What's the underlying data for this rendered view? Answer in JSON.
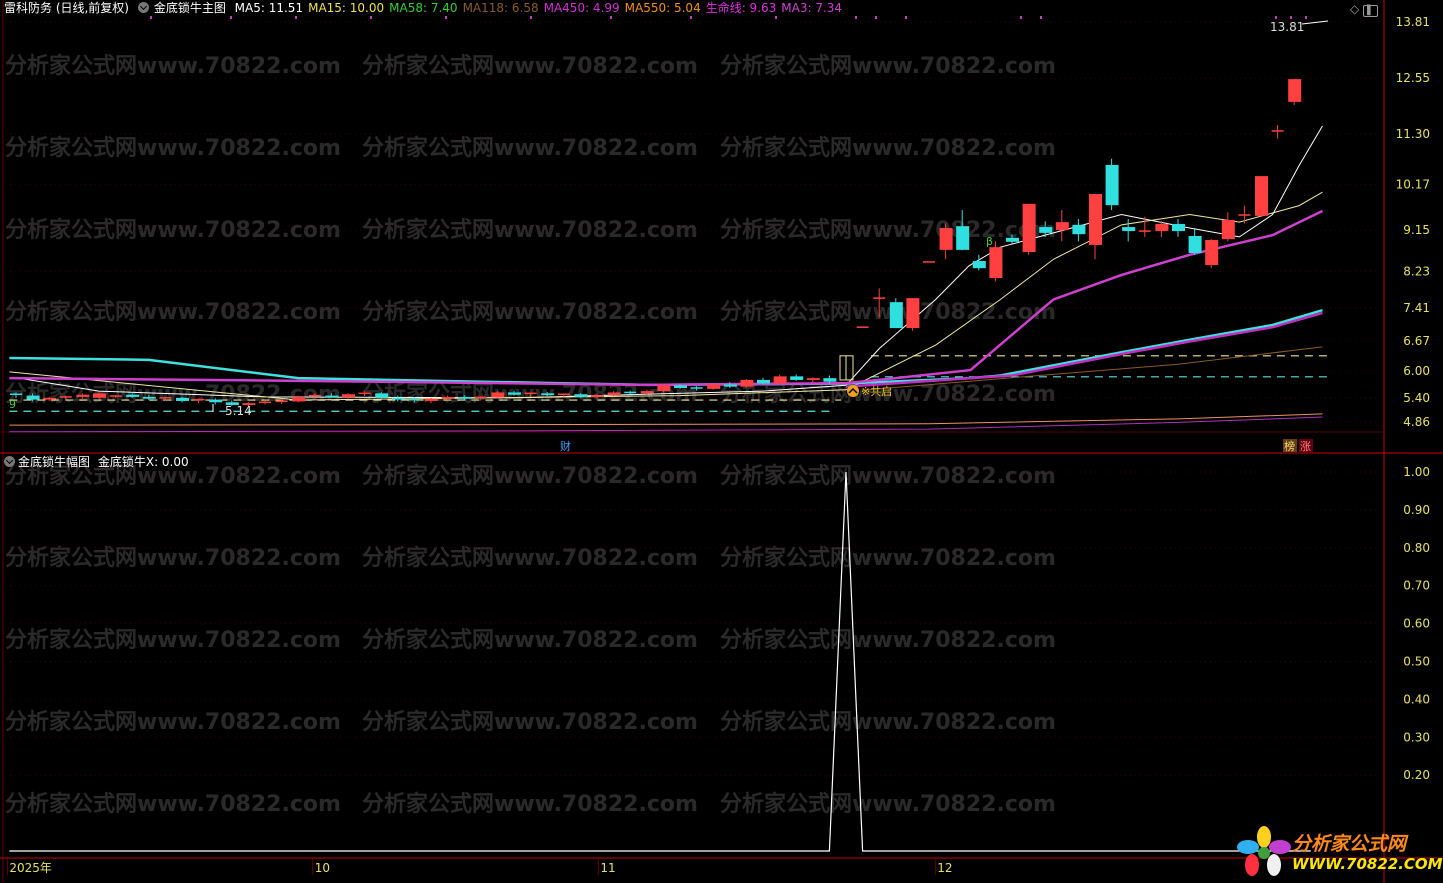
{
  "header": {
    "stock": "雷科防务 (日线,前复权)",
    "indicator": "金底锁牛主图",
    "items": [
      {
        "label": "MA5: 11.51",
        "color": "#ffffff"
      },
      {
        "label": "MA15: 10.00",
        "color": "#f0e050"
      },
      {
        "label": "MA58: 7.40",
        "color": "#30d030"
      },
      {
        "label": "MA118: 6.58",
        "color": "#8a5a2a"
      },
      {
        "label": "MA450: 4.99",
        "color": "#d030d0"
      },
      {
        "label": "MA550: 5.04",
        "color": "#f09020"
      },
      {
        "label": "生命线: 9.63",
        "color": "#e030e0"
      },
      {
        "label": "MA3: 7.34",
        "color": "#d040d0"
      }
    ]
  },
  "sub_header": {
    "indicator": "金底锁牛幅图",
    "value": "金底锁牛X: 0.00"
  },
  "price_axis": [
    "13.81",
    "12.55",
    "11.30",
    "10.17",
    "9.15",
    "8.23",
    "7.41",
    "6.67",
    "6.00",
    "5.40",
    "4.86"
  ],
  "sub_axis": [
    "1.00",
    "0.90",
    "0.80",
    "0.70",
    "0.60",
    "0.50",
    "0.40",
    "0.30",
    "0.20"
  ],
  "date_axis": [
    {
      "label": "2025年",
      "index": -0.4
    },
    {
      "label": "10",
      "index": 18
    },
    {
      "label": "11",
      "index": 35.2
    },
    {
      "label": "12",
      "index": 55.5
    }
  ],
  "annotations": {
    "low_label": "5.14",
    "high_label": "13.81",
    "signal_label": "※共启",
    "cai": "财",
    "bang": "榜",
    "zhang": "涨",
    "beta": "β",
    "nine": "9"
  },
  "watermark": "分析家公式网www.70822.com",
  "logo": {
    "title": "分析家公式网",
    "url": "WWW.70822.COM"
  },
  "colors": {
    "up": "#ff4040",
    "down": "#30e0e0",
    "axis": "#c80000",
    "tick": "#e8e060"
  },
  "chart_data": {
    "type": "candlestick",
    "price_range": [
      4.6,
      13.9
    ],
    "candles_ohlc": [
      [
        5.48,
        5.52,
        5.4,
        5.45
      ],
      [
        5.45,
        5.5,
        5.32,
        5.36
      ],
      [
        5.36,
        5.42,
        5.33,
        5.4
      ],
      [
        5.4,
        5.45,
        5.37,
        5.42
      ],
      [
        5.42,
        5.5,
        5.38,
        5.47
      ],
      [
        5.4,
        5.52,
        5.38,
        5.5
      ],
      [
        5.42,
        5.46,
        5.4,
        5.44
      ],
      [
        5.47,
        5.5,
        5.4,
        5.42
      ],
      [
        5.42,
        5.46,
        5.35,
        5.38
      ],
      [
        5.38,
        5.42,
        5.34,
        5.4
      ],
      [
        5.4,
        5.42,
        5.3,
        5.33
      ],
      [
        5.33,
        5.38,
        5.28,
        5.36
      ],
      [
        5.36,
        5.39,
        5.25,
        5.3
      ],
      [
        5.3,
        5.34,
        5.22,
        5.24
      ],
      [
        5.24,
        5.3,
        5.2,
        5.28
      ],
      [
        5.28,
        5.33,
        5.25,
        5.3
      ],
      [
        5.3,
        5.36,
        5.26,
        5.32
      ],
      [
        5.32,
        5.45,
        5.3,
        5.42
      ],
      [
        5.42,
        5.5,
        5.38,
        5.45
      ],
      [
        5.45,
        5.5,
        5.4,
        5.41
      ],
      [
        5.41,
        5.5,
        5.38,
        5.48
      ],
      [
        5.48,
        5.55,
        5.44,
        5.5
      ],
      [
        5.5,
        5.53,
        5.38,
        5.4
      ],
      [
        5.4,
        5.45,
        5.32,
        5.36
      ],
      [
        5.36,
        5.42,
        5.3,
        5.33
      ],
      [
        5.33,
        5.4,
        5.28,
        5.38
      ],
      [
        5.38,
        5.45,
        5.35,
        5.42
      ],
      [
        5.42,
        5.46,
        5.36,
        5.38
      ],
      [
        5.38,
        5.44,
        5.34,
        5.41
      ],
      [
        5.41,
        5.55,
        5.39,
        5.52
      ],
      [
        5.52,
        5.56,
        5.45,
        5.47
      ],
      [
        5.47,
        5.52,
        5.43,
        5.5
      ],
      [
        5.5,
        5.53,
        5.44,
        5.46
      ],
      [
        5.46,
        5.5,
        5.42,
        5.48
      ],
      [
        5.48,
        5.5,
        5.4,
        5.42
      ],
      [
        5.42,
        5.48,
        5.38,
        5.46
      ],
      [
        5.46,
        5.55,
        5.44,
        5.52
      ],
      [
        5.52,
        5.56,
        5.47,
        5.5
      ],
      [
        5.5,
        5.58,
        5.48,
        5.55
      ],
      [
        5.55,
        5.72,
        5.52,
        5.68
      ],
      [
        5.68,
        5.7,
        5.6,
        5.62
      ],
      [
        5.62,
        5.66,
        5.56,
        5.6
      ],
      [
        5.6,
        5.72,
        5.58,
        5.7
      ],
      [
        5.7,
        5.75,
        5.62,
        5.65
      ],
      [
        5.65,
        5.82,
        5.63,
        5.8
      ],
      [
        5.8,
        5.85,
        5.7,
        5.72
      ],
      [
        5.72,
        5.92,
        5.7,
        5.88
      ],
      [
        5.88,
        5.92,
        5.78,
        5.8
      ],
      [
        5.8,
        5.86,
        5.74,
        5.84
      ],
      [
        5.84,
        5.9,
        5.7,
        5.76
      ],
      [
        5.8,
        6.34,
        5.8,
        6.34
      ],
      [
        6.98,
        6.98,
        6.98,
        6.98
      ],
      [
        7.63,
        7.85,
        7.2,
        7.63
      ],
      [
        7.54,
        7.63,
        6.96,
        6.96
      ],
      [
        6.96,
        7.63,
        6.9,
        7.63
      ],
      [
        8.44,
        8.44,
        8.44,
        8.44
      ],
      [
        8.71,
        9.3,
        8.5,
        9.2
      ],
      [
        9.24,
        9.6,
        8.7,
        8.71
      ],
      [
        8.46,
        8.6,
        8.25,
        8.3
      ],
      [
        8.08,
        8.9,
        8.0,
        8.77
      ],
      [
        8.98,
        9.05,
        8.85,
        8.89
      ],
      [
        8.66,
        9.74,
        8.6,
        9.74
      ],
      [
        9.22,
        9.35,
        9.0,
        9.09
      ],
      [
        9.15,
        9.6,
        8.9,
        9.33
      ],
      [
        9.27,
        9.4,
        8.9,
        9.06
      ],
      [
        8.82,
        9.96,
        8.5,
        9.96
      ],
      [
        10.61,
        10.75,
        9.6,
        9.71
      ],
      [
        9.22,
        9.4,
        8.9,
        9.13
      ],
      [
        9.11,
        9.45,
        9.0,
        9.13
      ],
      [
        9.13,
        9.35,
        9.0,
        9.29
      ],
      [
        9.29,
        9.4,
        9.0,
        9.13
      ],
      [
        9.02,
        9.2,
        8.6,
        8.64
      ],
      [
        8.37,
        8.95,
        8.3,
        8.93
      ],
      [
        8.95,
        9.55,
        8.9,
        9.38
      ],
      [
        9.49,
        9.7,
        9.3,
        9.49
      ],
      [
        9.47,
        10.36,
        9.45,
        10.36
      ],
      [
        11.37,
        11.5,
        11.2,
        11.37
      ],
      [
        12.02,
        12.53,
        11.95,
        12.53
      ]
    ],
    "lines": [
      {
        "name": "MA5",
        "color": "#ffffff",
        "width": 1,
        "points": [
          [
            0,
            5.85
          ],
          [
            5,
            5.55
          ],
          [
            15,
            5.42
          ],
          [
            30,
            5.4
          ],
          [
            45,
            5.55
          ],
          [
            50,
            5.68
          ],
          [
            52,
            6.5
          ],
          [
            55.4,
            7.6
          ],
          [
            57.4,
            8.35
          ],
          [
            59.3,
            8.77
          ],
          [
            62.5,
            9.09
          ],
          [
            66.6,
            9.5
          ],
          [
            70.7,
            9.2
          ],
          [
            73.7,
            9.0
          ],
          [
            75.7,
            9.5
          ],
          [
            77.3,
            10.6
          ],
          [
            78.7,
            11.48
          ]
        ]
      },
      {
        "name": "MA15",
        "color": "#f0e8a0",
        "width": 1,
        "points": [
          [
            -0.4,
            5.98
          ],
          [
            17,
            5.35
          ],
          [
            40,
            5.45
          ],
          [
            50,
            5.58
          ],
          [
            55.4,
            6.58
          ],
          [
            59.3,
            7.6
          ],
          [
            62.5,
            8.5
          ],
          [
            66.6,
            9.27
          ],
          [
            70.7,
            9.5
          ],
          [
            73.7,
            9.33
          ],
          [
            77.3,
            9.7
          ],
          [
            78.7,
            10.0
          ]
        ]
      },
      {
        "name": "MA58",
        "color": "#40e0e0",
        "width": 2.5,
        "points": [
          [
            -0.4,
            6.29
          ],
          [
            8,
            6.25
          ],
          [
            17,
            5.84
          ],
          [
            38,
            5.69
          ],
          [
            50,
            5.72
          ],
          [
            57.5,
            5.84
          ],
          [
            59.3,
            5.9
          ],
          [
            66.6,
            6.42
          ],
          [
            70.7,
            6.7
          ],
          [
            75.7,
            7.03
          ],
          [
            78.7,
            7.36
          ]
        ]
      },
      {
        "name": "MA3",
        "color": "#d040d0",
        "width": 2.5,
        "points": [
          [
            -0.4,
            5.84
          ],
          [
            17,
            5.78
          ],
          [
            38,
            5.69
          ],
          [
            50,
            5.73
          ],
          [
            53,
            5.84
          ],
          [
            57.5,
            6.02
          ],
          [
            62.5,
            7.6
          ],
          [
            66.6,
            8.15
          ],
          [
            70.7,
            8.6
          ],
          [
            75.7,
            9.04
          ],
          [
            78.7,
            9.58
          ]
        ]
      },
      {
        "name": "MA3b",
        "color": "#c030c0",
        "width": 2.5,
        "points": [
          [
            50,
            5.65
          ],
          [
            57.5,
            5.84
          ],
          [
            60,
            5.9
          ],
          [
            66.6,
            6.38
          ],
          [
            70.7,
            6.66
          ],
          [
            75.7,
            6.98
          ],
          [
            78.7,
            7.3
          ]
        ]
      },
      {
        "name": "MA118",
        "color": "#8a5a2a",
        "width": 1,
        "points": [
          [
            51,
            5.57
          ],
          [
            60,
            5.85
          ],
          [
            70,
            6.15
          ],
          [
            78.7,
            6.54
          ]
        ]
      },
      {
        "name": "MA550",
        "color": "#f09060",
        "width": 1,
        "points": [
          [
            -0.4,
            4.79
          ],
          [
            30,
            4.8
          ],
          [
            55,
            4.82
          ],
          [
            70,
            4.93
          ],
          [
            78.7,
            5.04
          ]
        ]
      },
      {
        "name": "MA450",
        "color": "#b030c0",
        "width": 1,
        "points": [
          [
            -0.4,
            4.64
          ],
          [
            30,
            4.66
          ],
          [
            55,
            4.7
          ],
          [
            70,
            4.85
          ],
          [
            78.7,
            4.97
          ]
        ]
      }
    ],
    "dashed_levels": [
      {
        "price": 6.34,
        "from": 51.5,
        "to": 79.3,
        "color": "#f0e890"
      },
      {
        "price": 5.87,
        "from": 51.5,
        "to": 79.3,
        "color": "#60e0e0"
      },
      {
        "price": 5.35,
        "from": -0.4,
        "to": 49.7,
        "color": "#f0e890"
      },
      {
        "price": 5.1,
        "from": -0.4,
        "to": 49,
        "color": "#60e0e0"
      }
    ],
    "sub_series": {
      "name": "金底锁牛X",
      "range": [
        0,
        1.0
      ],
      "values_index_of_one": 50,
      "count": 79
    }
  }
}
